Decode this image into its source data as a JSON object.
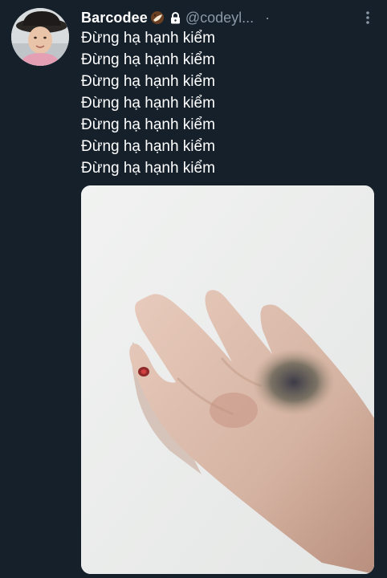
{
  "tweet": {
    "author": {
      "display_name": "Barcodee",
      "emoji": "coconut-icon",
      "protected": true,
      "handle": "@codeyl...",
      "separator": "·"
    },
    "text_lines": [
      "Đừng hạ hạnh kiểm",
      "Đừng hạ hạnh kiểm",
      "Đừng hạ hạnh kiểm",
      "Đừng hạ hạnh kiểm",
      "Đừng hạ hạnh kiểm",
      "Đừng hạ hạnh kiểm",
      "Đừng hạ hạnh kiểm"
    ]
  },
  "colors": {
    "background": "#15202b",
    "text_primary": "#ffffff",
    "text_secondary": "#8b98a5"
  }
}
